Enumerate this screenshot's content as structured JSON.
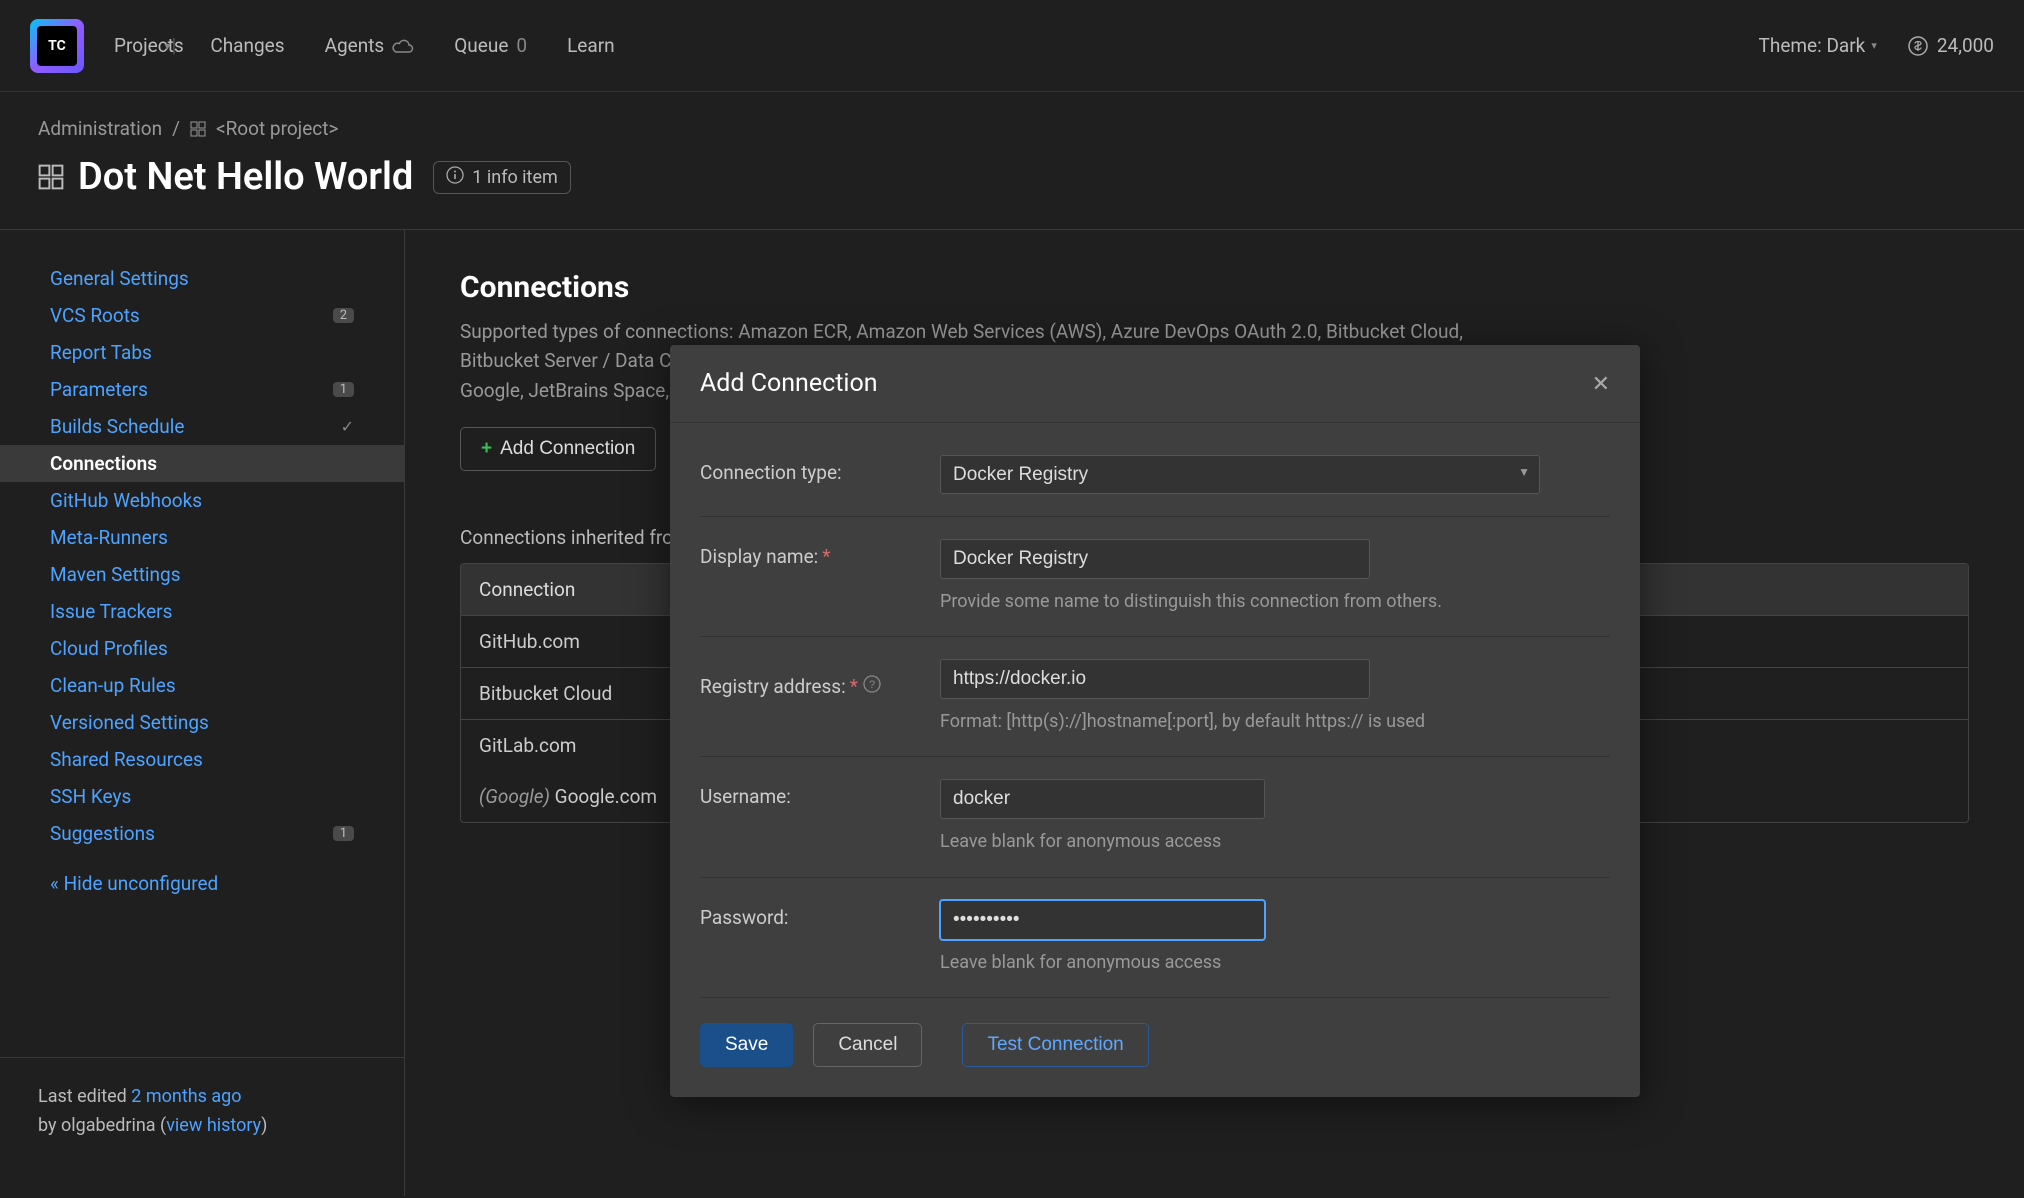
{
  "header": {
    "logo_text": "TC",
    "nav": {
      "projects": "Projects",
      "changes": "Changes",
      "agents": "Agents",
      "queue": "Queue",
      "queue_count": "0",
      "learn": "Learn"
    },
    "theme_label": "Theme: Dark",
    "notif_count": "24,000"
  },
  "breadcrumb": {
    "admin": "Administration",
    "root": "<Root project>"
  },
  "page": {
    "title": "Dot Net Hello World",
    "info_item": "1 info item"
  },
  "sidebar": {
    "items": [
      {
        "label": "General Settings",
        "badge": "",
        "check": false
      },
      {
        "label": "VCS Roots",
        "badge": "2",
        "check": false
      },
      {
        "label": "Report Tabs",
        "badge": "",
        "check": false
      },
      {
        "label": "Parameters",
        "badge": "1",
        "check": false
      },
      {
        "label": "Builds Schedule",
        "badge": "",
        "check": true
      },
      {
        "label": "Connections",
        "badge": "",
        "check": false
      },
      {
        "label": "GitHub Webhooks",
        "badge": "",
        "check": false
      },
      {
        "label": "Meta-Runners",
        "badge": "",
        "check": false
      },
      {
        "label": "Maven Settings",
        "badge": "",
        "check": false
      },
      {
        "label": "Issue Trackers",
        "badge": "",
        "check": false
      },
      {
        "label": "Cloud Profiles",
        "badge": "",
        "check": false
      },
      {
        "label": "Clean-up Rules",
        "badge": "",
        "check": false
      },
      {
        "label": "Versioned Settings",
        "badge": "",
        "check": false
      },
      {
        "label": "Shared Resources",
        "badge": "",
        "check": false
      },
      {
        "label": "SSH Keys",
        "badge": "",
        "check": false
      },
      {
        "label": "Suggestions",
        "badge": "1",
        "check": false
      }
    ],
    "hide": "« Hide unconfigured",
    "footer": {
      "last_edited": "Last edited",
      "when": "2 months ago",
      "by_label": "by",
      "user": "olgabedrina",
      "view_history": "view history"
    }
  },
  "main": {
    "heading": "Connections",
    "desc": "Supported types of connections: Amazon ECR, Amazon Web Services (AWS), Azure DevOps OAuth 2.0, Bitbucket Cloud, Bitbucket Server / Data Center, Docker Registry, GitHub App, GitHub Enterprise, GitHub.com, GitLab CE/EE, GitLab.com, Google, JetBrains Space, NPM Registry, NuGet Feed, Perforce Administrator Access, Slack, Azure DevOps PAT.",
    "add_btn": "Add Connection",
    "inherited_title": "Connections inherited from parent projects",
    "table_head": "Connection",
    "rows": [
      "GitHub.com",
      "Bitbucket Cloud",
      "GitLab.com"
    ],
    "google_prefix": "(Google)",
    "google_value": "Google.com"
  },
  "dialog": {
    "title": "Add Connection",
    "labels": {
      "type": "Connection type:",
      "display_name": "Display name:",
      "registry": "Registry address:",
      "username": "Username:",
      "password": "Password:"
    },
    "values": {
      "type": "Docker Registry",
      "display_name": "Docker Registry",
      "registry": "https://docker.io",
      "username": "docker",
      "password": "••••••••••"
    },
    "hints": {
      "display_name": "Provide some name to distinguish this connection from others.",
      "registry": "Format: [http(s)://]hostname[:port], by default https:// is used",
      "username": "Leave blank for anonymous access",
      "password": "Leave blank for anonymous access"
    },
    "buttons": {
      "save": "Save",
      "cancel": "Cancel",
      "test": "Test Connection"
    }
  }
}
